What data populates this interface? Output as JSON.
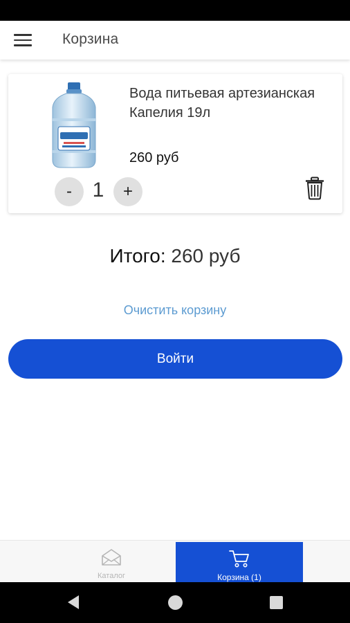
{
  "app_bar": {
    "title": "Корзина",
    "menu_icon": "hamburger-menu-icon"
  },
  "cart_items": [
    {
      "name": "Вода питьевая артезианская Капелия 19л",
      "price": "260 руб",
      "quantity": "1",
      "decrease_label": "-",
      "increase_label": "+",
      "image": "water-bottle-19l",
      "delete_icon": "trash-icon"
    }
  ],
  "summary": {
    "total_label": "Итого:",
    "total_value": "260 руб"
  },
  "clear_cart_label": "Очистить корзину",
  "login_button_label": "Войти",
  "bottom_nav": {
    "tabs": [
      {
        "label": "Каталог",
        "icon": "envelope-icon",
        "active": false
      },
      {
        "label": "Корзина (1)",
        "icon": "cart-icon",
        "active": true
      }
    ]
  },
  "colors": {
    "primary": "#1550d4",
    "link": "#5c9bd1",
    "status_bar": "#000000"
  }
}
